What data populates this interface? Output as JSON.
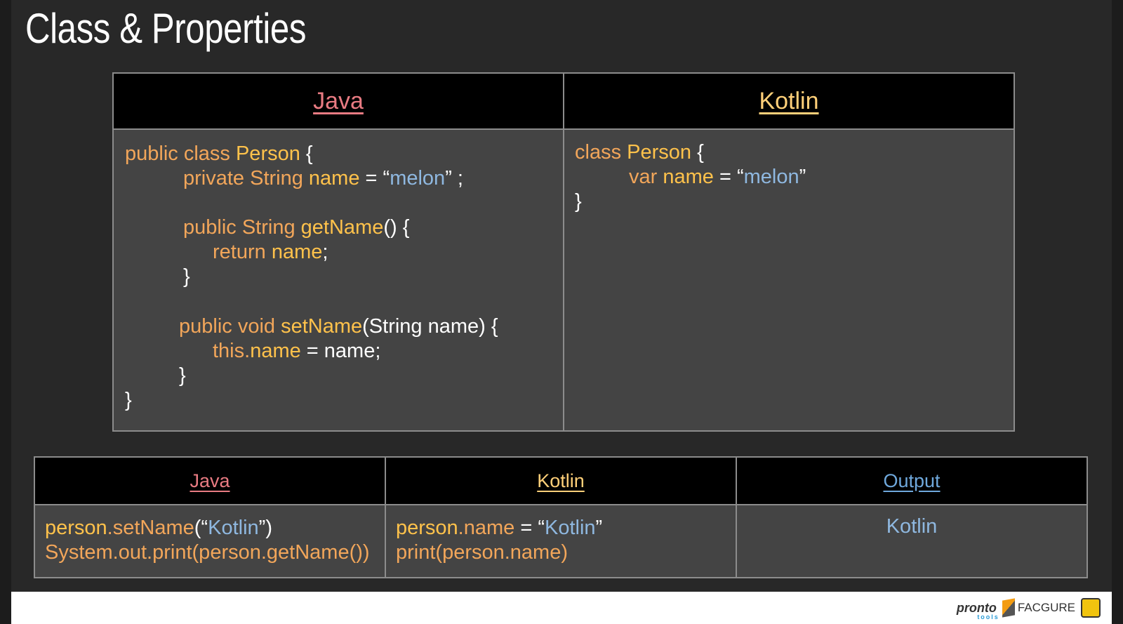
{
  "title": "Class & Properties",
  "top_table": {
    "java_header": "Java",
    "kotlin_header": "Kotlin",
    "java_code": [
      [
        [
          "k",
          "public class "
        ],
        [
          "y",
          "Person "
        ],
        [
          "w",
          "{"
        ]
      ],
      [
        [
          "k",
          "private String "
        ],
        [
          "y",
          "name "
        ],
        [
          "w",
          "= “"
        ],
        [
          "s",
          "melon"
        ],
        [
          "w",
          "” ;"
        ]
      ],
      [
        [
          "k",
          "public String "
        ],
        [
          "y",
          "getName"
        ],
        [
          "w",
          "() {"
        ]
      ],
      [
        [
          "k",
          "return "
        ],
        [
          "y",
          "name"
        ],
        [
          "w",
          ";"
        ]
      ],
      [
        [
          "w",
          "}"
        ]
      ],
      [
        [
          "k",
          "public void "
        ],
        [
          "y",
          "setName"
        ],
        [
          "w",
          "(String name) {"
        ]
      ],
      [
        [
          "k",
          "this."
        ],
        [
          "y",
          "name "
        ],
        [
          "w",
          "= name;"
        ]
      ],
      [
        [
          "w",
          "}"
        ]
      ],
      [
        [
          "w",
          "}"
        ]
      ]
    ],
    "kotlin_code": [
      [
        [
          "k",
          "class "
        ],
        [
          "y",
          "Person "
        ],
        [
          "w",
          "{"
        ]
      ],
      [
        [
          "k",
          "var "
        ],
        [
          "y",
          "name "
        ],
        [
          "w",
          "= “"
        ],
        [
          "s",
          "melon"
        ],
        [
          "w",
          "”"
        ]
      ],
      [
        [
          "w",
          "}"
        ]
      ]
    ]
  },
  "bottom_table": {
    "java_header": "Java",
    "kotlin_header": "Kotlin",
    "output_header": "Output",
    "java_code": [
      [
        [
          "y",
          "person"
        ],
        [
          "k",
          ".setName"
        ],
        [
          "w",
          "(“"
        ],
        [
          "s",
          "Kotlin"
        ],
        [
          "w",
          "”)"
        ]
      ],
      [
        [
          "k",
          "System.out.print(person.getName())"
        ]
      ]
    ],
    "kotlin_code": [
      [
        [
          "y",
          "person"
        ],
        [
          "k",
          ".name "
        ],
        [
          "w",
          "= “"
        ],
        [
          "s",
          "Kotlin"
        ],
        [
          "w",
          "”"
        ]
      ],
      [
        [
          "k",
          "print(person.name)"
        ]
      ]
    ],
    "output": "Kotlin"
  },
  "footer": {
    "logo1": "pronto",
    "logo1_sub": "tools",
    "logo2": "FACGURE"
  }
}
